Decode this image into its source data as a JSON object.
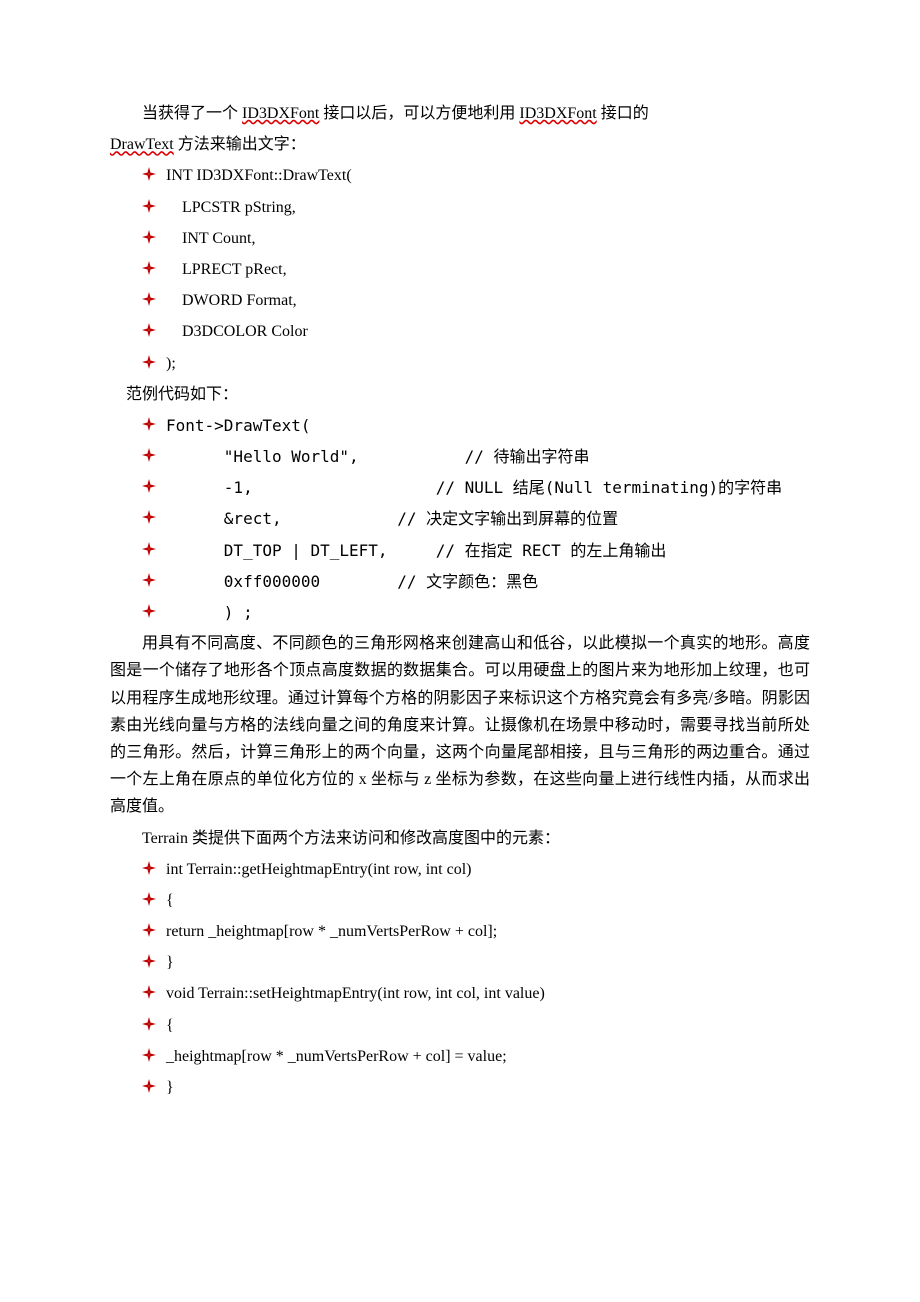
{
  "para1_pre": "当获得了一个 ",
  "para1_u1": "ID3DXFont",
  "para1_mid1": " 接口以后，可以方便地利用 ",
  "para1_u2": "ID3DXFont",
  "para1_mid2": " 接口的",
  "para1_line2_u": "DrawText",
  "para1_line2_rest": " 方法来输出文字：",
  "code1": [
    "INT ID3DXFont::DrawText(",
    "    LPCSTR pString,",
    "    INT Count,",
    "    LPRECT pRect,",
    "    DWORD Format,",
    "    D3DCOLOR Color",
    ");"
  ],
  "label_example": "范例代码如下：",
  "code2": [
    "Font->DrawText(",
    "      \"Hello World\",           // 待输出字符串",
    "      -1,                   // NULL 结尾(Null terminating)的字符串",
    "      &rect,            // 决定文字输出到屏幕的位置",
    "      DT_TOP | DT_LEFT,     // 在指定 RECT 的左上角输出",
    "      0xff000000        // 文字颜色：黑色",
    "      ) ;"
  ],
  "para2": "用具有不同高度、不同颜色的三角形网格来创建高山和低谷，以此模拟一个真实的地形。高度图是一个储存了地形各个顶点高度数据的数据集合。可以用硬盘上的图片来为地形加上纹理，也可以用程序生成地形纹理。通过计算每个方格的阴影因子来标识这个方格究竟会有多亮/多暗。阴影因素由光线向量与方格的法线向量之间的角度来计算。让摄像机在场景中移动时，需要寻找当前所处的三角形。然后，计算三角形上的两个向量，这两个向量尾部相接，且与三角形的两边重合。通过一个左上角在原点的单位化方位的 x 坐标与 z 坐标为参数，在这些向量上进行线性内插，从而求出高度值。",
  "para3": "Terrain 类提供下面两个方法来访问和修改高度图中的元素：",
  "code3": [
    "int Terrain::getHeightmapEntry(int row, int col)",
    "{",
    "return _heightmap[row * _numVertsPerRow + col];",
    "}",
    "void Terrain::setHeightmapEntry(int row, int col, int value)",
    "{",
    "_heightmap[row * _numVertsPerRow + col] = value;",
    "}"
  ]
}
